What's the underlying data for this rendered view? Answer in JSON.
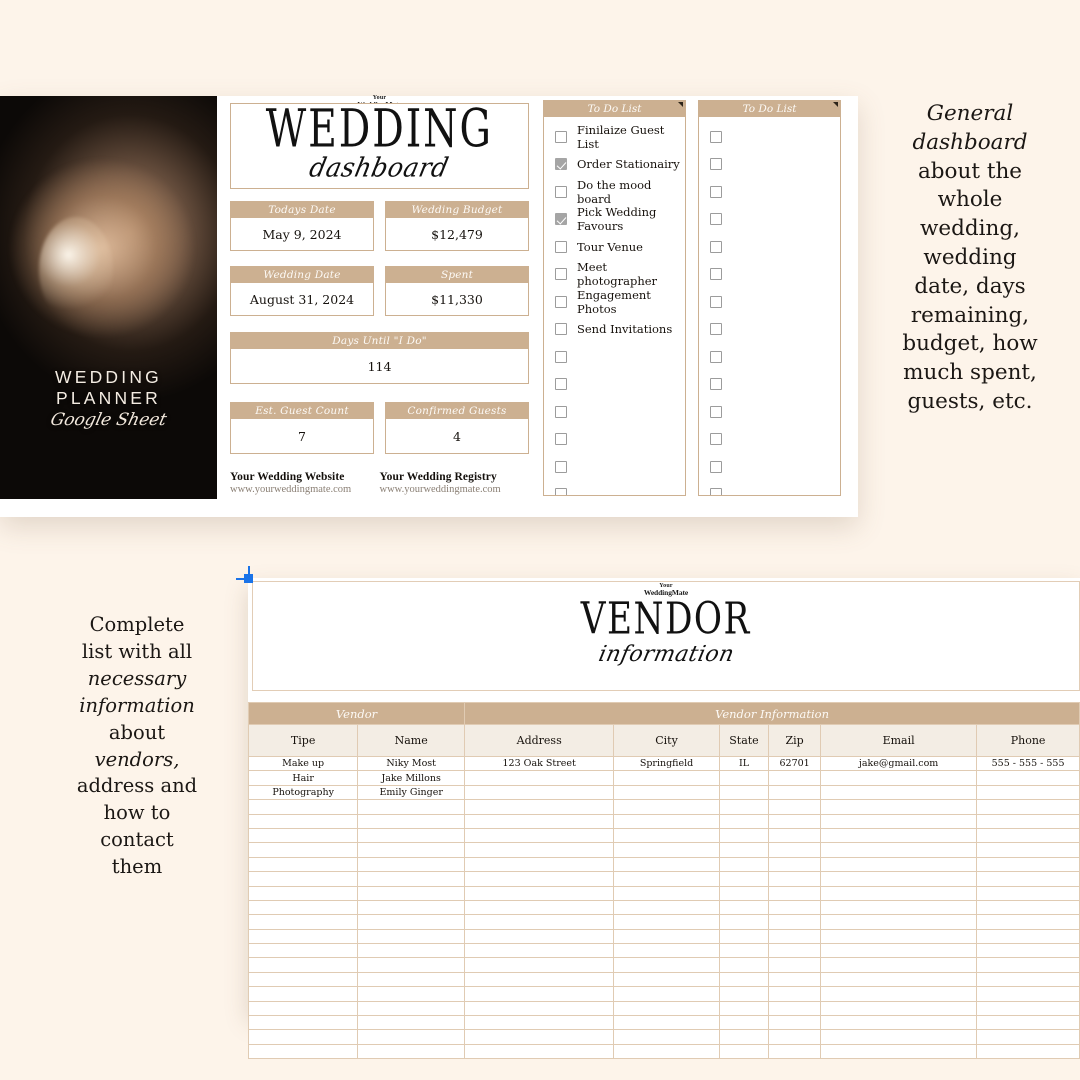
{
  "photo_panel": {
    "title": "WEDDING PLANNER",
    "subtitle": "Google Sheet"
  },
  "brand": {
    "line1": "Your",
    "line2": "WeddingMate"
  },
  "dashboard": {
    "title_main": "WEDDING",
    "title_script": "dashboard",
    "fields": [
      {
        "label": "Todays Date",
        "value": "May 9, 2024"
      },
      {
        "label": "Wedding Budget",
        "value": "$12,479"
      },
      {
        "label": "Wedding Date",
        "value": "August 31, 2024"
      },
      {
        "label": "Spent",
        "value": "$11,330"
      },
      {
        "label": "Days Until \"I Do\"",
        "value": "114"
      },
      {
        "label": "Est. Guest Count",
        "value": "7"
      },
      {
        "label": "Confirmed Guests",
        "value": "4"
      }
    ],
    "links": [
      {
        "title": "Your Wedding Website",
        "url": "www.yourweddingmate.com"
      },
      {
        "title": "Your Wedding Registry",
        "url": "www.yourweddingmate.com"
      }
    ]
  },
  "todo_left": {
    "header": "To Do List",
    "items": [
      {
        "label": "Finilaize Guest List",
        "checked": false
      },
      {
        "label": "Order Stationairy",
        "checked": true
      },
      {
        "label": "Do the mood board",
        "checked": false
      },
      {
        "label": "Pick Wedding Favours",
        "checked": true
      },
      {
        "label": "Tour Venue",
        "checked": false
      },
      {
        "label": "Meet photographer",
        "checked": false
      },
      {
        "label": "Engagement Photos",
        "checked": false
      },
      {
        "label": "Send Invitations",
        "checked": false
      },
      {
        "label": "",
        "checked": false
      },
      {
        "label": "",
        "checked": false
      },
      {
        "label": "",
        "checked": false
      },
      {
        "label": "",
        "checked": false
      },
      {
        "label": "",
        "checked": false
      },
      {
        "label": "",
        "checked": false
      }
    ]
  },
  "todo_right": {
    "header": "To Do List",
    "items": [
      {
        "label": "",
        "checked": false
      },
      {
        "label": "",
        "checked": false
      },
      {
        "label": "",
        "checked": false
      },
      {
        "label": "",
        "checked": false
      },
      {
        "label": "",
        "checked": false
      },
      {
        "label": "",
        "checked": false
      },
      {
        "label": "",
        "checked": false
      },
      {
        "label": "",
        "checked": false
      },
      {
        "label": "",
        "checked": false
      },
      {
        "label": "",
        "checked": false
      },
      {
        "label": "",
        "checked": false
      },
      {
        "label": "",
        "checked": false
      },
      {
        "label": "",
        "checked": false
      },
      {
        "label": "",
        "checked": false
      }
    ]
  },
  "right_copy": {
    "lines": [
      "General",
      "dashboard",
      "about the",
      "whole",
      "wedding,",
      "wedding",
      "date, days",
      "remaining,",
      "budget, how",
      "much spent,",
      "guests, etc."
    ],
    "italic_count": 2
  },
  "left_copy": {
    "lines": [
      "Complete",
      "list with all",
      "necessary",
      "information",
      "about",
      "vendors,",
      "address and",
      "how to",
      "contact",
      "them"
    ],
    "italic_indices": [
      2,
      3,
      5
    ]
  },
  "vendor": {
    "title_main": "VENDOR",
    "title_script": "information",
    "group_headers": [
      "Vendor",
      "Vendor Information"
    ],
    "columns": [
      "Tipe",
      "Name",
      "Address",
      "City",
      "State",
      "Zip",
      "Email",
      "Phone"
    ],
    "rows": [
      [
        "Make up",
        "Niky Most",
        "123 Oak Street",
        "Springfield",
        "IL",
        "62701",
        "jake@gmail.com",
        "555 - 555 - 555"
      ],
      [
        "Hair",
        "Jake Millons",
        "",
        "",
        "",
        "",
        "",
        ""
      ],
      [
        "Photography",
        "Emily Ginger",
        "",
        "",
        "",
        "",
        "",
        ""
      ]
    ],
    "empty_row_count": 18
  },
  "colors": {
    "tan": "#ccb091",
    "cream_bg": "#fdf4ea",
    "border": "#e0cbb3",
    "col_header_bg": "#f3ede4",
    "selection_blue": "#1a73e8"
  }
}
